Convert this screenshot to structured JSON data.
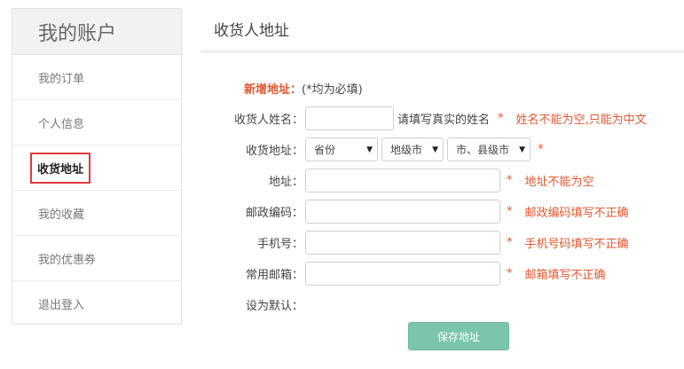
{
  "sidebar": {
    "title": "我的账户",
    "items": [
      {
        "label": "我的订单"
      },
      {
        "label": "个人信息"
      },
      {
        "label": "收货地址"
      },
      {
        "label": "我的收藏"
      },
      {
        "label": "我的优惠券"
      },
      {
        "label": "退出登入"
      }
    ],
    "active_index": 2
  },
  "main": {
    "title": "收货人地址",
    "new_address_label": "新增地址：",
    "required_note": "(*均为必填)",
    "fields": {
      "name": {
        "label": "收货人姓名：",
        "value": "",
        "hint": "请填写真实的姓名",
        "star": "*",
        "error": "姓名不能为空,只能为中文"
      },
      "region": {
        "label": "收货地址：",
        "province": "省份",
        "city": "地级市",
        "county": "市、县级市",
        "star": "*"
      },
      "address": {
        "label": "地址：",
        "value": "",
        "star": "*",
        "error": "地址不能为空"
      },
      "postcode": {
        "label": "邮政编码：",
        "value": "",
        "star": "*",
        "error": "邮政编码填写不正确"
      },
      "phone": {
        "label": "手机号：",
        "value": "",
        "star": "*",
        "error": "手机号码填写不正确"
      },
      "email": {
        "label": "常用邮箱：",
        "value": "",
        "star": "*",
        "error": "邮箱填写不正确"
      },
      "default": {
        "label": "设为默认："
      }
    },
    "save_label": "保存地址"
  },
  "colors": {
    "accent": "#e4572e",
    "save_button": "#7bc6ab",
    "active_border": "#e0393e"
  }
}
